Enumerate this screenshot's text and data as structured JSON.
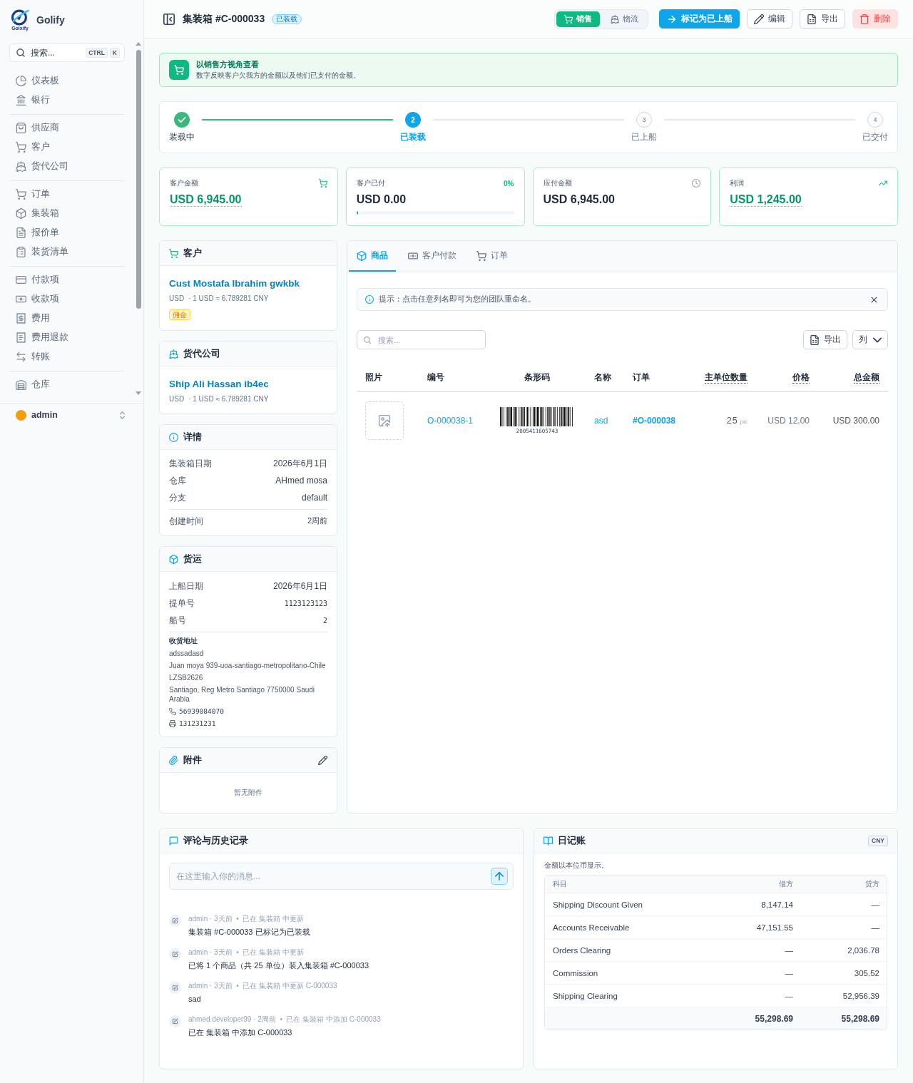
{
  "sidebar": {
    "brand": {
      "name": "Golify",
      "logo_caption": "Golxify"
    },
    "search": {
      "placeholder": "搜索...",
      "shortcut": [
        "CTRL",
        "K"
      ]
    },
    "groups": [
      {
        "items": [
          {
            "label": "仪表板",
            "selected": false
          },
          {
            "label": "银行",
            "selected": false
          }
        ]
      },
      {
        "items": [
          {
            "label": "供应商",
            "selected": false
          },
          {
            "label": "客户",
            "selected": false
          },
          {
            "label": "货代公司",
            "selected": false
          }
        ]
      },
      {
        "items": [
          {
            "label": "订单",
            "selected": false
          },
          {
            "label": "集装箱",
            "selected": false
          },
          {
            "label": "报价单",
            "selected": false
          },
          {
            "label": "装货清单",
            "selected": false
          }
        ]
      },
      {
        "items": [
          {
            "label": "付款项",
            "selected": false
          },
          {
            "label": "收款项",
            "selected": false
          },
          {
            "label": "费用",
            "selected": false
          },
          {
            "label": "费用退款",
            "selected": false
          },
          {
            "label": "转账",
            "selected": false
          }
        ]
      },
      {
        "items": [
          {
            "label": "仓库",
            "selected": false
          }
        ]
      }
    ],
    "user": {
      "name": "admin"
    }
  },
  "header": {
    "title": "集装箱 #C-000033",
    "status": "已装载",
    "view_toggle": [
      {
        "label": "销售",
        "selected": true
      },
      {
        "label": "物流",
        "selected": false
      }
    ],
    "actions": [
      {
        "label": "标记为已上船",
        "kind": "primary"
      },
      {
        "label": "编辑",
        "kind": "outline"
      },
      {
        "label": "导出",
        "kind": "outline"
      },
      {
        "label": "删除",
        "kind": "danger"
      }
    ]
  },
  "notice": {
    "title": "以销售方视角查看",
    "text": "数字反映客户欠我方的金额以及他们已支付的金额。"
  },
  "steps": [
    {
      "label": "装载中",
      "completed": true,
      "active": false
    },
    {
      "label": "已装载",
      "number": "2",
      "completed": false,
      "active": true
    },
    {
      "label": "已上船",
      "number": "3",
      "completed": false,
      "active": false
    },
    {
      "label": "已交付",
      "number": "4",
      "completed": false,
      "active": false
    }
  ],
  "stats": [
    {
      "kind": "receivable",
      "label": "客户金额",
      "value": "USD 6,945.00",
      "highlighted": true
    },
    {
      "kind": "paid",
      "label": "客户已付",
      "value": "USD 0.00",
      "highlighted": false,
      "percent": "0%",
      "level": 0
    },
    {
      "kind": "payable",
      "label": "应付金额",
      "value": "USD 6,945.00",
      "highlighted": false
    },
    {
      "kind": "profit",
      "label": "利润",
      "value": "USD 1,245.00",
      "highlighted": true
    }
  ],
  "customer": {
    "title": "客户",
    "name": "Cust Mostafa Ibrahim gwkbk",
    "currency": "USD",
    "rate": "· 1 USD ≈ 6.789281 CNY",
    "tags": [
      "佣金"
    ]
  },
  "forwarder": {
    "title": "货代公司",
    "name": "Ship Ali Hassan ib4ec",
    "currency": "USD",
    "rate": "· 1 USD ≈ 6.789281 CNY"
  },
  "details": {
    "title": "详情",
    "rows": [
      {
        "label": "集装箱日期",
        "value": "2026年6月1日"
      },
      {
        "label": "仓库",
        "value": "AHmed mosa"
      },
      {
        "label": "分支",
        "value": "default"
      }
    ],
    "footer_row": {
      "label": "创建时间",
      "value": "2周前"
    }
  },
  "shipping": {
    "title": "货运",
    "rows": [
      {
        "label": "上船日期",
        "value": "2026年6月1日"
      },
      {
        "label": "提单号",
        "value": "1123123123"
      },
      {
        "label": "船号",
        "value": "2"
      }
    ],
    "address": {
      "title": "收货地址",
      "lines": [
        "adssadasd",
        "Juan moya 939-uoa-santiago-metropolitano-Chile",
        "LZSB2626",
        "Santiago, Reg Metro Santiago 7750000 Saudi Arabia"
      ],
      "phone": "56939084070",
      "fax": "131231231"
    }
  },
  "attachments": {
    "title": "附件",
    "empty_text": "暂无附件"
  },
  "products": {
    "tabs": [
      {
        "label": "商品",
        "selected": true
      },
      {
        "label": "客户付款",
        "selected": false
      },
      {
        "label": "订单",
        "selected": false
      }
    ],
    "tip": "提示：点击任意列名即可为您的团队重命名。",
    "search": {
      "placeholder": "搜索..."
    },
    "export_label": "导出",
    "columns_label": "列",
    "table": {
      "columns": [
        {
          "label": "照片",
          "has_tooltip": false
        },
        {
          "label": "编号",
          "has_tooltip": false
        },
        {
          "label": "条形码",
          "has_tooltip": false
        },
        {
          "label": "名称",
          "has_tooltip": false
        },
        {
          "label": "订单",
          "has_tooltip": false
        },
        {
          "label": "主单位数量",
          "has_tooltip": true
        },
        {
          "label": "价格",
          "has_tooltip": true
        },
        {
          "label": "总金额",
          "has_tooltip": true
        }
      ],
      "rows": [
        {
          "code": "O-000038-1",
          "barcode": "2005411605743",
          "name": "asd",
          "order": "#O-000038",
          "quantity": "25",
          "unit": "pic",
          "price": "USD 12.00",
          "total": "USD 300.00"
        }
      ]
    }
  },
  "comments": {
    "title": "评论与历史记录",
    "input": {
      "placeholder": "在这里输入你的消息..."
    },
    "history": [
      {
        "meta": "admin · 3天前  •  已在 集装箱 中更新",
        "text": "集装箱 #C-000033 已标记为已装载"
      },
      {
        "meta": "admin · 3天前  •  已在 集装箱 中更新",
        "text": "已将 1 个商品（共 25 单位）装入集装箱 #C-000033"
      },
      {
        "meta": "admin · 3天前  •  已在 集装箱 中更新 C-000033",
        "text": "sad"
      },
      {
        "meta": "ahmed.developer99 · 2周前  •  已在 集装箱 中添加 C-000033",
        "text": "已在 集装箱 中添加 C-000033"
      }
    ]
  },
  "journal": {
    "title": "日记账",
    "currency": "CNY",
    "note": "金额以本位币显示。",
    "columns": [
      "科目",
      "借方",
      "贷方"
    ],
    "rows": [
      {
        "account": "Shipping Discount Given",
        "debit": "8,147.14",
        "credit": "—"
      },
      {
        "account": "Accounts Receivable",
        "debit": "47,151.55",
        "credit": "—"
      },
      {
        "account": "Orders Clearing",
        "debit": "—",
        "credit": "2,036.78"
      },
      {
        "account": "Commission",
        "debit": "—",
        "credit": "305.52"
      },
      {
        "account": "Shipping Clearing",
        "debit": "—",
        "credit": "52,956.39"
      }
    ],
    "totals": {
      "debit": "55,298.69",
      "credit": "55,298.69"
    }
  }
}
